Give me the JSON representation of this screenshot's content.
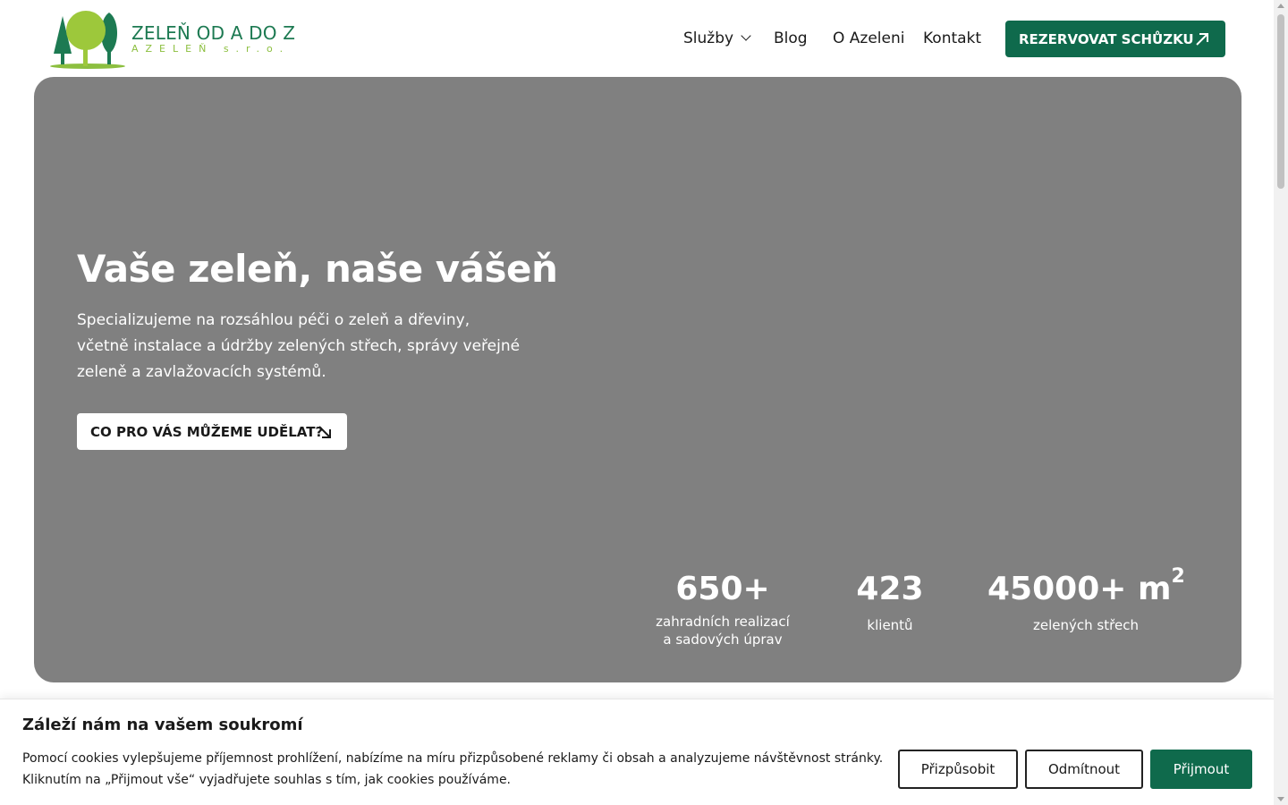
{
  "brand": {
    "title": "ZELEŇ OD A DO Z",
    "subtitle": "AZELEŇ s.r.o.",
    "colors": {
      "primary": "#0f6a4c",
      "light_green": "#8cbf3f"
    }
  },
  "nav": {
    "items": [
      {
        "label": "Služby",
        "has_dropdown": true
      },
      {
        "label": "Blog"
      },
      {
        "label": "O Azeleni"
      },
      {
        "label": "Kontakt"
      }
    ],
    "cta_label": "REZERVOVAT SCHŮZKU",
    "cta_icon": "arrow-up-right-icon"
  },
  "hero": {
    "title": "Vaše zeleň, naše vášeň",
    "text": "Specializujeme na rozsáhlou péči o zeleň a dřeviny, včetně instalace a údržby zelených střech, správy veřejné zeleně a zavlažovacích systémů.",
    "button_label": "CO PRO VÁS MŮŽEME UDĚLAT?",
    "button_icon": "arrow-down-right-icon",
    "stats": [
      {
        "value": "650+",
        "label_line1": "zahradních realizací",
        "label_line2": "a sadových úprav"
      },
      {
        "value": "423",
        "label_line1": "klientů",
        "label_line2": ""
      },
      {
        "value": "45000+ m",
        "sup": "2",
        "label_line1": "zelených střech",
        "label_line2": ""
      }
    ]
  },
  "cookie": {
    "title": "Záleží nám na vašem soukromí",
    "text": "Pomocí cookies vylepšujeme příjemnost prohlížení, nabízíme na míru přizpůsobené reklamy či obsah a analyzujeme návštěvnost stránky. Kliknutím na „Přijmout vše“ vyjadřujete souhlas s tím, jak cookies používáme.",
    "customize_label": "Přizpůsobit",
    "reject_label": "Odmítnout",
    "accept_label": "Přijmout"
  }
}
